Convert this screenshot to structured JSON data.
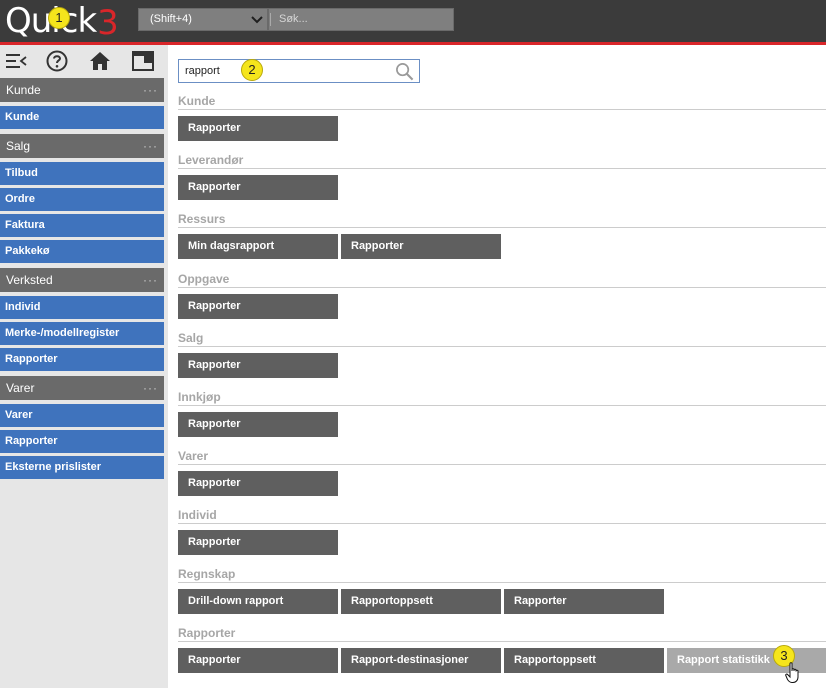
{
  "app": {
    "logo_text": "Quick",
    "logo_number": "3"
  },
  "topbar": {
    "shortcut_label": "(Shift+4)",
    "search_placeholder": "Søk..."
  },
  "badges": [
    "1",
    "2",
    "3"
  ],
  "sidebar": {
    "icons": [
      "collapse-menu-icon",
      "help-icon",
      "home-icon",
      "window-icon"
    ],
    "sections": [
      {
        "title": "Kunde",
        "items": [
          "Kunde"
        ]
      },
      {
        "title": "Salg",
        "items": [
          "Tilbud",
          "Ordre",
          "Faktura",
          "Pakkekø"
        ]
      },
      {
        "title": "Verksted",
        "items": [
          "Individ",
          "Merke-/modellregister",
          "Rapporter"
        ]
      },
      {
        "title": "Varer",
        "items": [
          "Varer",
          "Rapporter",
          "Eksterne prislister"
        ]
      }
    ],
    "more_indicator": "···"
  },
  "main": {
    "search_value": "rapport",
    "groups": [
      {
        "title": "Kunde",
        "buttons": [
          "Rapporter"
        ]
      },
      {
        "title": "Leverandør",
        "buttons": [
          "Rapporter"
        ]
      },
      {
        "title": "Ressurs",
        "buttons": [
          "Min dagsrapport",
          "Rapporter"
        ]
      },
      {
        "title": "Oppgave",
        "buttons": [
          "Rapporter"
        ]
      },
      {
        "title": "Salg",
        "buttons": [
          "Rapporter"
        ]
      },
      {
        "title": "Innkjøp",
        "buttons": [
          "Rapporter"
        ]
      },
      {
        "title": "Varer",
        "buttons": [
          "Rapporter"
        ]
      },
      {
        "title": "Individ",
        "buttons": [
          "Rapporter"
        ]
      },
      {
        "title": "Regnskap",
        "buttons": [
          "Drill-down rapport",
          "Rapportoppsett",
          "Rapporter"
        ]
      },
      {
        "title": "Rapporter",
        "buttons": [
          "Rapporter",
          "Rapport-destinasjoner",
          "Rapportoppsett",
          "Rapport statistikk"
        ]
      }
    ]
  },
  "colors": {
    "accent_red": "#d9262a",
    "nav_blue": "#3f73bd",
    "button_gray": "#5f5f5f",
    "hover_gray": "#a9a9a9",
    "badge_yellow": "#f5e51c"
  }
}
